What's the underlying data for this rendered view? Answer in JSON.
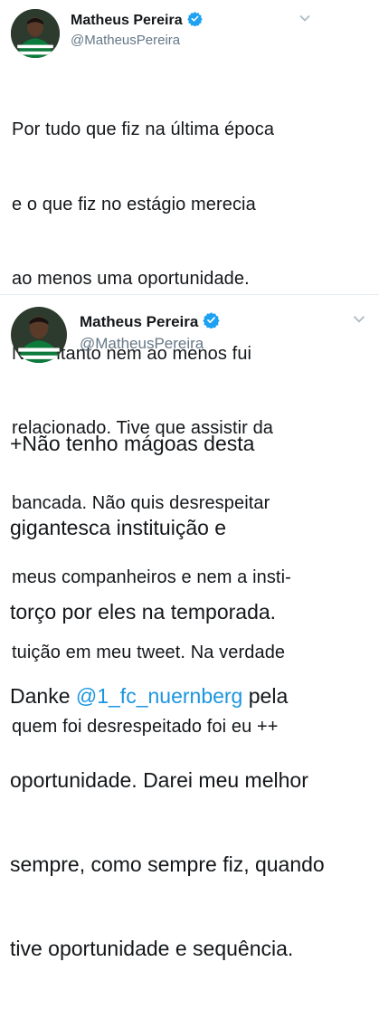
{
  "tweets": [
    {
      "author": {
        "name": "Matheus Pereira",
        "handle": "@MatheusPereira"
      },
      "icons": {
        "avatar": "avatar-photo",
        "verified": "verified-badge-icon",
        "menu": "chevron-down-icon"
      },
      "text_lines": [
        "Por tudo que fiz na última época",
        "e o que fiz no estágio merecia",
        "ao menos uma oportunidade.",
        "No entanto nem ao menos fui",
        "relacionado. Tive que assistir da",
        "bancada. Não quis desrespeitar",
        "meus companheiros e nem a insti-",
        "tuição em meu tweet. Na verdade",
        "quem foi desrespeitado foi eu ++"
      ]
    },
    {
      "author": {
        "name": "Matheus Pereira",
        "handle": "@MatheusPereira"
      },
      "icons": {
        "avatar": "avatar-photo",
        "verified": "verified-badge-icon",
        "menu": "chevron-down-icon"
      },
      "text_lines": [
        "+Não tenho mágoas desta",
        "gigantesca instituição e",
        "torço por eles na temporada.",
        {
          "before": "Danke ",
          "mention": "@1_fc_nuernberg",
          "after": " pela"
        },
        "oportunidade. Darei meu melhor",
        "sempre, como sempre fiz, quando",
        "tive oportunidade e sequência."
      ]
    }
  ],
  "colors": {
    "text": "#14171a",
    "secondary": "#657786",
    "link": "#1b95e0",
    "verified": "#1da1f2",
    "divider": "#e6ecf0",
    "jersey_green": "#0b7a3b"
  }
}
